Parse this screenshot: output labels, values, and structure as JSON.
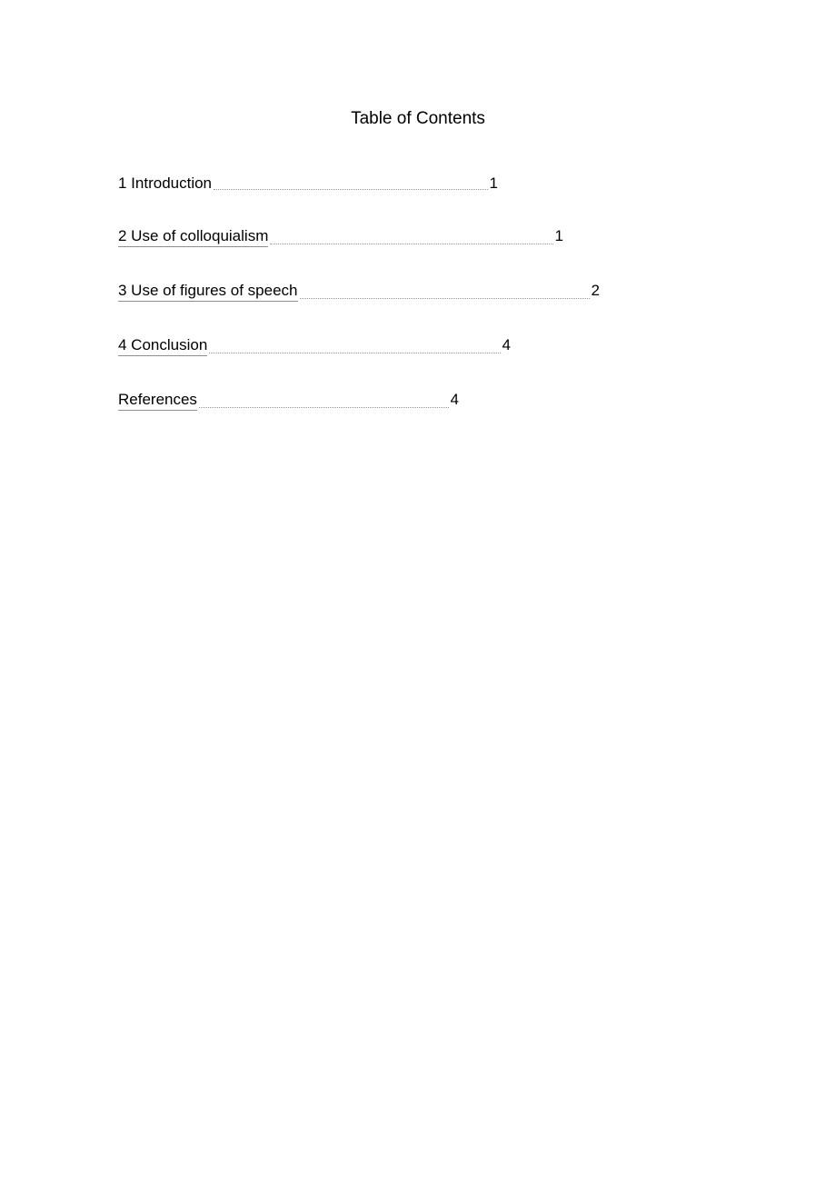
{
  "title": "Table of Contents",
  "entries": [
    {
      "label": "1 Introduction",
      "page": "1",
      "underlined": false
    },
    {
      "label": "2 Use of colloquialism",
      "page": "1",
      "underlined": true
    },
    {
      "label": "3   Use of figures of speech",
      "page": "2",
      "underlined": true
    },
    {
      "label": "4 Conclusion",
      "page": "4",
      "underlined": true
    },
    {
      "label": "References",
      "page": "4",
      "underlined": true
    }
  ]
}
